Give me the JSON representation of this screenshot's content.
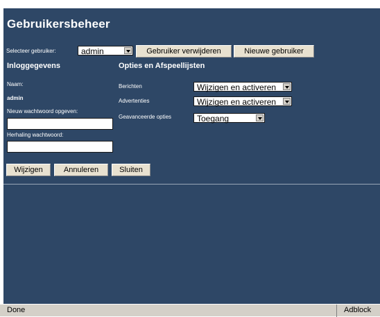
{
  "page": {
    "title": "Gebruikersbeheer"
  },
  "user_select": {
    "label": "Selecteer gebruiker:",
    "value": "admin",
    "delete_button": "Gebruiker verwijderen",
    "new_button": "Nieuwe gebruiker"
  },
  "login": {
    "header": "Inloggegevens",
    "name_label": "Naam:",
    "name_value": "admin",
    "new_password_label": "Nieuw wachtwoord opgeven:",
    "new_password_value": "",
    "repeat_password_label": "Herhaling wachtwoord:",
    "repeat_password_value": ""
  },
  "options": {
    "header": "Opties en Afspeellijsten",
    "rows": [
      {
        "label": "Berichten",
        "value": "Wijzigen en activeren"
      },
      {
        "label": "Advertenties",
        "value": "Wijzigen en activeren"
      },
      {
        "label": "Geavanceerde opties",
        "value": "Toegang"
      }
    ]
  },
  "actions": {
    "change": "Wijzigen",
    "cancel": "Annuleren",
    "close": "Sluiten"
  },
  "statusbar": {
    "left": "Done",
    "right": "Adblock"
  },
  "colors": {
    "panel": "#2e4766",
    "button": "#e8e1d0",
    "statusbar": "#d4d0c8"
  }
}
